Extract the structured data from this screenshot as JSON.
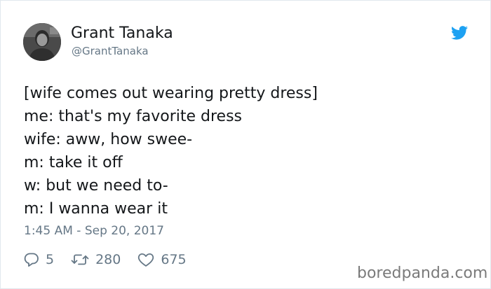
{
  "author": {
    "display_name": "Grant Tanaka",
    "handle": "@GrantTanaka"
  },
  "tweet": {
    "lines": [
      "[wife comes out wearing pretty dress]",
      "me: that's my favorite dress",
      "wife: aww, how swee-",
      "m: take it off",
      "w: but we need to-",
      "m: I wanna wear it"
    ],
    "timestamp": "1:45 AM - Sep 20, 2017"
  },
  "actions": {
    "replies": "5",
    "retweets": "280",
    "likes": "675"
  },
  "icons": {
    "brand": "twitter-bird-icon",
    "reply": "reply-bubble-icon",
    "retweet": "retweet-icon",
    "like": "heart-icon"
  },
  "colors": {
    "twitter_blue": "#1da1f2",
    "text": "#14171a",
    "secondary_text": "#657786",
    "border": "#e1e8ed"
  },
  "watermark": "boredpanda.com"
}
